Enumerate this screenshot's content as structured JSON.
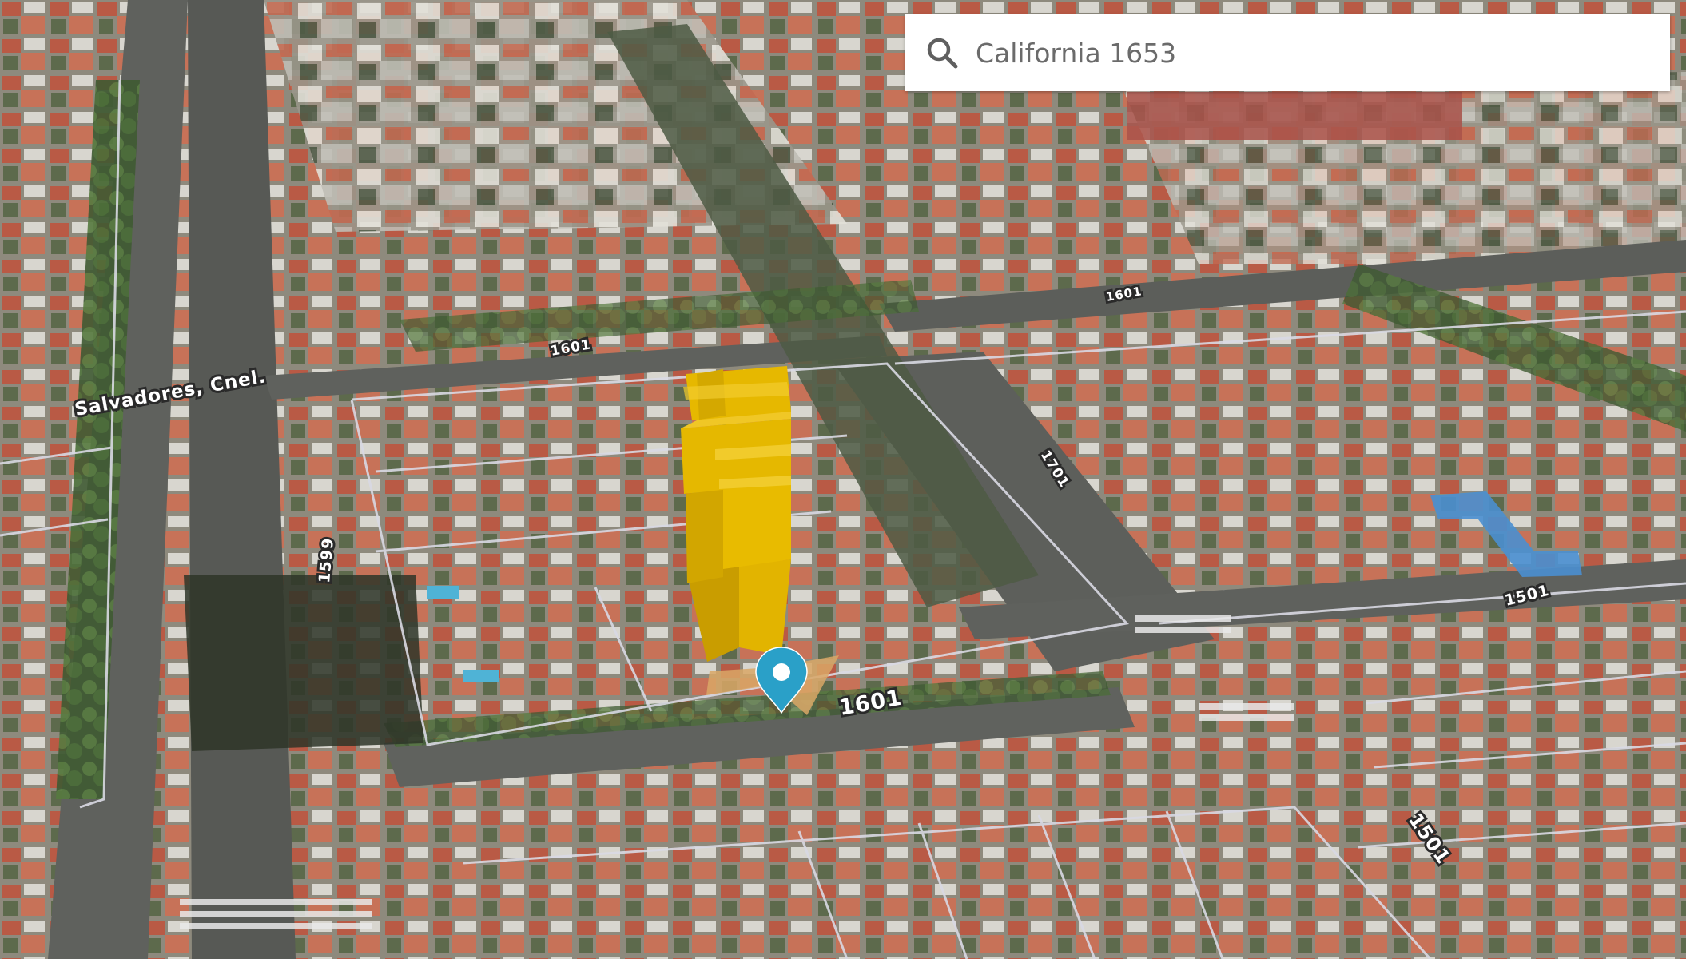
{
  "search": {
    "value": "California 1653"
  },
  "map": {
    "street_labels": [
      {
        "id": "salvadores",
        "text": "Salvadores, Cnel."
      },
      {
        "id": "n1601-upper",
        "text": "1601"
      },
      {
        "id": "n1599",
        "text": "1599"
      },
      {
        "id": "n1601-main",
        "text": "1601"
      },
      {
        "id": "n1701",
        "text": "1701"
      },
      {
        "id": "n1601-right",
        "text": "1601"
      },
      {
        "id": "n1501-right",
        "text": "1501"
      },
      {
        "id": "n1501-bottom",
        "text": "1501"
      }
    ],
    "highlighted_building_color": "#e2b400",
    "pin_color": "#2aa0c8",
    "parcel_line_color": "#d9d9e3"
  },
  "icons": {
    "search": "search-icon",
    "pin": "location-pin-icon"
  }
}
